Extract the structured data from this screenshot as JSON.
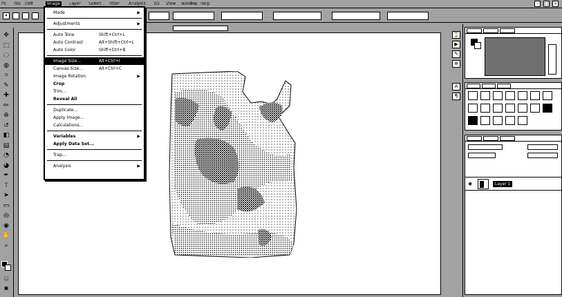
{
  "menubar": {
    "items": [
      "Ps",
      "File",
      "Edit",
      "Image",
      "Layer",
      "Select",
      "Filter",
      "Analysis",
      "3D",
      "View",
      "Window",
      "Help"
    ],
    "active_index": 3
  },
  "image_menu": {
    "items": [
      {
        "label": "Mode",
        "submenu": true
      },
      {
        "separator": true
      },
      {
        "label": "Adjustments",
        "submenu": true
      },
      {
        "separator": true
      },
      {
        "label": "Auto Tone",
        "shortcut": "Shift+Ctrl+L"
      },
      {
        "label": "Auto Contrast",
        "shortcut": "Alt+Shift+Ctrl+L"
      },
      {
        "label": "Auto Color",
        "shortcut": "Shift+Ctrl+B"
      },
      {
        "separator": true
      },
      {
        "label": "Image Size...",
        "shortcut": "Alt+Ctrl+I",
        "highlighted": true
      },
      {
        "label": "Canvas Size...",
        "shortcut": "Alt+Ctrl+C"
      },
      {
        "label": "Image Rotation",
        "submenu": true
      },
      {
        "label": "Crop",
        "bold": true
      },
      {
        "label": "Trim..."
      },
      {
        "label": "Reveal All",
        "bold": true
      },
      {
        "separator": true
      },
      {
        "label": "Duplicate..."
      },
      {
        "label": "Apply Image..."
      },
      {
        "label": "Calculations..."
      },
      {
        "separator": true
      },
      {
        "label": "Variables",
        "submenu": true,
        "bold": true
      },
      {
        "label": "Apply Data Set...",
        "bold": true
      },
      {
        "separator": true
      },
      {
        "label": "Trap..."
      },
      {
        "separator": true
      },
      {
        "label": "Analysis",
        "submenu": true
      }
    ]
  },
  "tools": [
    "move-icon",
    "marquee-icon",
    "lasso-icon",
    "quick-select-icon",
    "crop-icon",
    "eyedropper-icon",
    "healing-icon",
    "brush-icon",
    "stamp-icon",
    "history-brush-icon",
    "eraser-icon",
    "gradient-icon",
    "blur-icon",
    "dodge-icon",
    "pen-icon",
    "type-icon",
    "path-select-icon",
    "shape-icon",
    "3d-rotate-icon",
    "3d-orbit-icon",
    "hand-icon",
    "zoom-icon"
  ],
  "tool_glyphs": [
    "✥",
    "⬚",
    "◌",
    "◍",
    "⌗",
    "✎",
    "✚",
    "✏",
    "⊕",
    "↺",
    "◧",
    "▤",
    "◔",
    "◕",
    "✒",
    "T",
    "➤",
    "▭",
    "◎",
    "◉",
    "✋",
    "⌕"
  ],
  "layers_panel": {
    "layer_name": "Layer 1"
  },
  "colors": {
    "foreground": "#000000",
    "background": "#ffffff"
  }
}
